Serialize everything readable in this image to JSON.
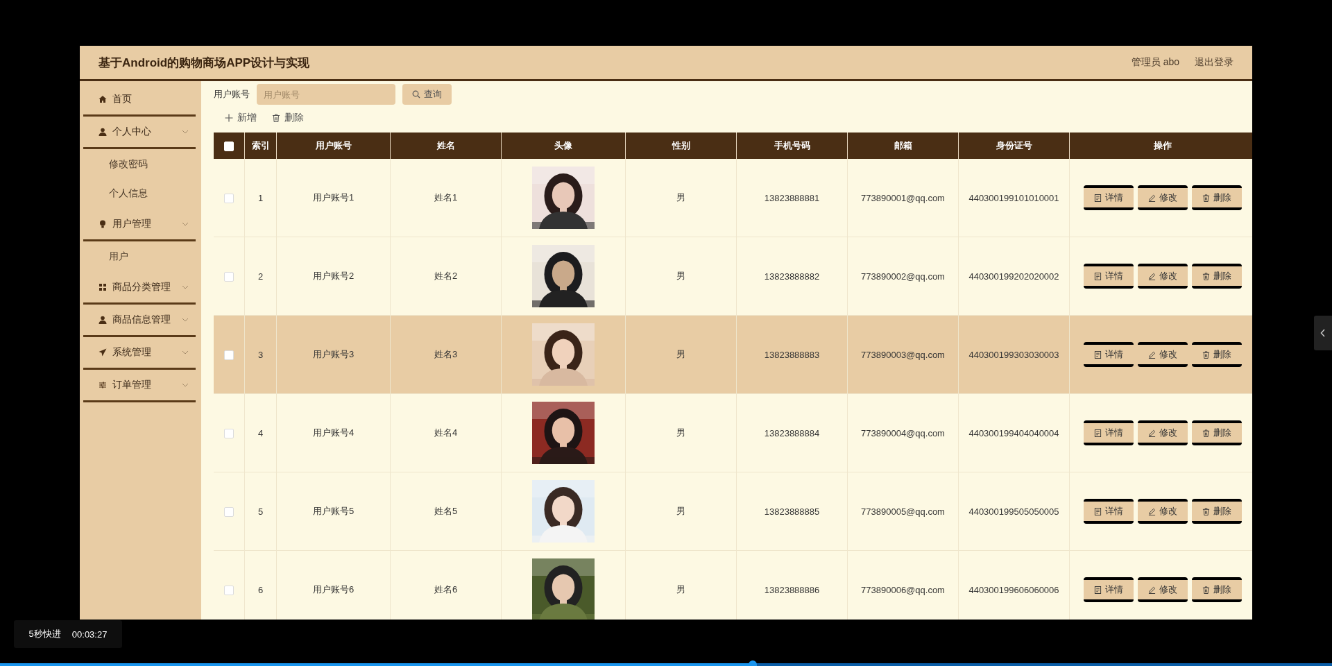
{
  "header": {
    "title": "基于Android的购物商场APP设计与实现",
    "user": "管理员 abo",
    "logout": "退出登录"
  },
  "sidebar": {
    "items": [
      {
        "label": "首页",
        "expandable": false
      },
      {
        "label": "个人中心",
        "expandable": true,
        "children": [
          {
            "label": "修改密码"
          },
          {
            "label": "个人信息"
          }
        ]
      },
      {
        "label": "用户管理",
        "expandable": true,
        "children": [
          {
            "label": "用户"
          }
        ]
      },
      {
        "label": "商品分类管理",
        "expandable": true
      },
      {
        "label": "商品信息管理",
        "expandable": true
      },
      {
        "label": "系统管理",
        "expandable": true
      },
      {
        "label": "订单管理",
        "expandable": true
      }
    ]
  },
  "search": {
    "label": "用户账号",
    "placeholder": "用户账号",
    "button": "查询"
  },
  "toolbar": [
    "新增",
    "删除"
  ],
  "table": {
    "header_checkbox": {
      "checked": false
    },
    "columns": [
      "索引",
      "用户账号",
      "姓名",
      "头像",
      "性别",
      "手机号码",
      "邮箱",
      "身份证号",
      "操作"
    ],
    "rows": [
      {
        "checked": false,
        "hovered": false,
        "index": "1",
        "account": "用户账号1",
        "name": "姓名1",
        "gender": "男",
        "phone": "13823888881",
        "email": "773890001@qq.com",
        "id_number": "440300199101010001",
        "actions": [
          "详情",
          "修改",
          "删除"
        ]
      },
      {
        "checked": false,
        "hovered": false,
        "index": "2",
        "account": "用户账号2",
        "name": "姓名2",
        "gender": "男",
        "phone": "13823888882",
        "email": "773890002@qq.com",
        "id_number": "440300199202020002",
        "actions": [
          "详情",
          "修改",
          "删除"
        ]
      },
      {
        "checked": false,
        "hovered": true,
        "index": "3",
        "account": "用户账号3",
        "name": "姓名3",
        "gender": "男",
        "phone": "13823888883",
        "email": "773890003@qq.com",
        "id_number": "440300199303030003",
        "actions": [
          "详情",
          "修改",
          "删除"
        ]
      },
      {
        "checked": false,
        "hovered": false,
        "index": "4",
        "account": "用户账号4",
        "name": "姓名4",
        "gender": "男",
        "phone": "13823888884",
        "email": "773890004@qq.com",
        "id_number": "440300199404040004",
        "actions": [
          "详情",
          "修改",
          "删除"
        ]
      },
      {
        "checked": false,
        "hovered": false,
        "index": "5",
        "account": "用户账号5",
        "name": "姓名5",
        "gender": "男",
        "phone": "13823888885",
        "email": "773890005@qq.com",
        "id_number": "440300199505050005",
        "actions": [
          "详情",
          "修改",
          "删除"
        ]
      },
      {
        "checked": false,
        "hovered": false,
        "index": "6",
        "account": "用户账号6",
        "name": "姓名6",
        "gender": "男",
        "phone": "13823888886",
        "email": "773890006@qq.com",
        "id_number": "440300199606060006",
        "actions": [
          "详情",
          "修改",
          "删除"
        ]
      }
    ]
  },
  "player": {
    "skip": "5秒快进",
    "time": "00:03:27",
    "level": 0.565
  }
}
